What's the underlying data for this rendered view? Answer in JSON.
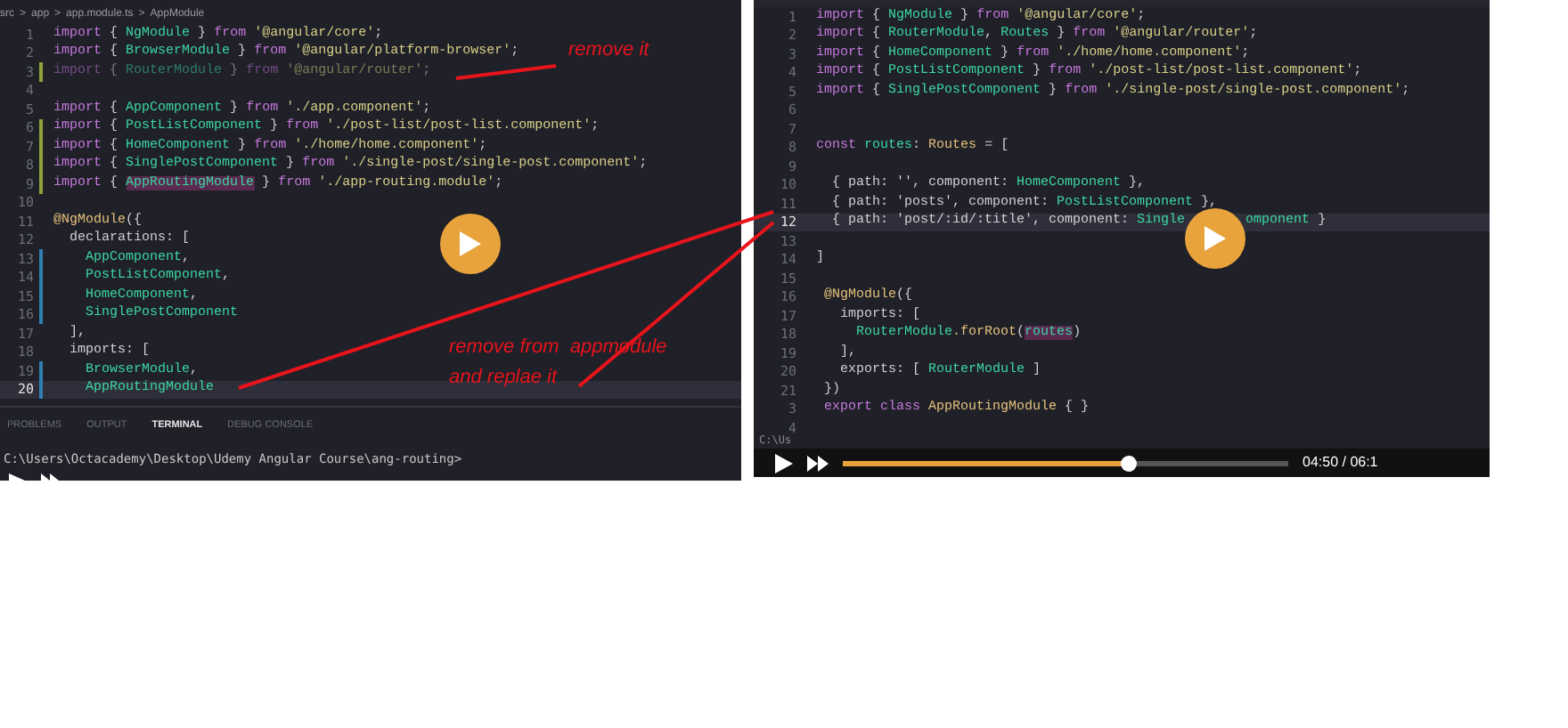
{
  "left_frame": {
    "breadcrumb": [
      "src",
      ">",
      "app",
      ">",
      "app.module.ts",
      ">",
      "AppModule"
    ],
    "code_lines": [
      {
        "number": "1",
        "current": false,
        "tokens": [
          {
            "text": "import",
            "kind": "kw"
          },
          {
            "text": " { ",
            "kind": "p"
          },
          {
            "text": "NgModule",
            "kind": "id"
          },
          {
            "text": " } ",
            "kind": "p"
          },
          {
            "text": "from ",
            "kind": "kw"
          },
          {
            "text": "'@angular/core'",
            "kind": "str"
          },
          {
            "text": ";",
            "kind": "p"
          }
        ]
      },
      {
        "number": "2",
        "current": false,
        "tokens": [
          {
            "text": "import",
            "kind": "kw"
          },
          {
            "text": " { ",
            "kind": "p"
          },
          {
            "text": "BrowserModule",
            "kind": "id"
          },
          {
            "text": " } ",
            "kind": "p"
          },
          {
            "text": "from ",
            "kind": "kw"
          },
          {
            "text": "'@angular/platform-browser'",
            "kind": "str"
          },
          {
            "text": ";",
            "kind": "p"
          }
        ]
      },
      {
        "number": "3",
        "current": false,
        "faded": true,
        "color": "#8fa33a",
        "tokens": [
          {
            "text": "import",
            "kind": "kw"
          },
          {
            "text": " { ",
            "kind": "p"
          },
          {
            "text": "RouterModule",
            "kind": "id"
          },
          {
            "text": " } ",
            "kind": "p"
          },
          {
            "text": "from ",
            "kind": "kw"
          },
          {
            "text": "'@angular/router'",
            "kind": "str"
          },
          {
            "text": ";",
            "kind": "p"
          }
        ]
      },
      {
        "number": "4",
        "current": false
      },
      {
        "number": "5",
        "current": false,
        "tokens": [
          {
            "text": "import",
            "kind": "kw"
          },
          {
            "text": " { ",
            "kind": "p"
          },
          {
            "text": "AppComponent",
            "kind": "id"
          },
          {
            "text": " } ",
            "kind": "p"
          },
          {
            "text": "from ",
            "kind": "kw"
          },
          {
            "text": "'./app.component'",
            "kind": "str"
          },
          {
            "text": ";",
            "kind": "p"
          }
        ]
      },
      {
        "number": "6",
        "current": false,
        "color": "#8fa33a",
        "tokens": [
          {
            "text": "import",
            "kind": "kw"
          },
          {
            "text": " { ",
            "kind": "p"
          },
          {
            "text": "PostListComponent",
            "kind": "id"
          },
          {
            "text": " } ",
            "kind": "p"
          },
          {
            "text": "from ",
            "kind": "kw"
          },
          {
            "text": "'./post-list/post-list.component'",
            "kind": "str"
          },
          {
            "text": ";",
            "kind": "p"
          }
        ]
      },
      {
        "number": "7",
        "current": false,
        "color": "#8fa33a",
        "tokens": [
          {
            "text": "import",
            "kind": "kw"
          },
          {
            "text": " { ",
            "kind": "p"
          },
          {
            "text": "HomeComponent",
            "kind": "id"
          },
          {
            "text": " } ",
            "kind": "p"
          },
          {
            "text": "from ",
            "kind": "kw"
          },
          {
            "text": "'./home/home.component'",
            "kind": "str"
          },
          {
            "text": ";",
            "kind": "p"
          }
        ]
      },
      {
        "number": "8",
        "current": false,
        "color": "#8fa33a",
        "tokens": [
          {
            "text": "import",
            "kind": "kw"
          },
          {
            "text": " { ",
            "kind": "p"
          },
          {
            "text": "SinglePostComponent",
            "kind": "id"
          },
          {
            "text": " } ",
            "kind": "p"
          },
          {
            "text": "from ",
            "kind": "kw"
          },
          {
            "text": "'./single-post/single-post.component'",
            "kind": "str"
          },
          {
            "text": ";",
            "kind": "p"
          }
        ]
      },
      {
        "number": "9",
        "current": false,
        "color": "#8fa33a",
        "tokens": [
          {
            "text": "import",
            "kind": "kw"
          },
          {
            "text": " { ",
            "kind": "p"
          },
          {
            "text": "AppRoutingModule",
            "kind": "id",
            "selected": true
          },
          {
            "text": " } ",
            "kind": "p"
          },
          {
            "text": "from ",
            "kind": "kw"
          },
          {
            "text": "'./app-routing.module'",
            "kind": "str"
          },
          {
            "text": ";",
            "kind": "p"
          }
        ]
      },
      {
        "number": "10",
        "current": false
      },
      {
        "number": "11",
        "current": false,
        "tokens": [
          {
            "text": "@NgModule",
            "kind": "dec"
          },
          {
            "text": "({",
            "kind": "p"
          }
        ]
      },
      {
        "number": "12",
        "current": false,
        "tokens": [
          {
            "text": "  declarations: [",
            "kind": "p"
          }
        ]
      },
      {
        "number": "13",
        "current": false,
        "color": "#2f7fb0",
        "tokens": [
          {
            "text": "    AppComponent",
            "kind": "id"
          },
          {
            "text": ",",
            "kind": "p"
          }
        ]
      },
      {
        "number": "14",
        "current": false,
        "color": "#2f7fb0",
        "tokens": [
          {
            "text": "    PostListComponent",
            "kind": "id"
          },
          {
            "text": ",",
            "kind": "p"
          }
        ]
      },
      {
        "number": "15",
        "current": false,
        "color": "#2f7fb0",
        "tokens": [
          {
            "text": "    HomeComponent",
            "kind": "id"
          },
          {
            "text": ",",
            "kind": "p"
          }
        ]
      },
      {
        "number": "16",
        "current": false,
        "color": "#2f7fb0",
        "tokens": [
          {
            "text": "    SinglePostComponent",
            "kind": "id"
          }
        ]
      },
      {
        "number": "17",
        "current": false,
        "tokens": [
          {
            "text": "  ],",
            "kind": "p"
          }
        ]
      },
      {
        "number": "18",
        "current": false,
        "tokens": [
          {
            "text": "  imports: [",
            "kind": "p"
          }
        ]
      },
      {
        "number": "19",
        "current": false,
        "color": "#2f7fb0",
        "tokens": [
          {
            "text": "    BrowserModule",
            "kind": "id"
          },
          {
            "text": ",",
            "kind": "p"
          }
        ]
      },
      {
        "number": "20",
        "current": true,
        "color": "#2f7fb0",
        "tokens": [
          {
            "text": "    AppRoutingModule",
            "kind": "id"
          }
        ]
      }
    ],
    "panel_tabs": [
      {
        "label": "PROBLEMS",
        "selected": false
      },
      {
        "label": "OUTPUT",
        "selected": false
      },
      {
        "label": "TERMINAL",
        "selected": true
      },
      {
        "label": "DEBUG CONSOLE",
        "selected": false
      }
    ],
    "terminal_line": "C:\\Users\\Octacademy\\Desktop\\Udemy Angular Course\\ang-routing>"
  },
  "right_frame": {
    "code_lines": [
      {
        "number": "1",
        "current": false,
        "tokens": [
          {
            "text": "import",
            "kind": "kw"
          },
          {
            "text": " { ",
            "kind": "p"
          },
          {
            "text": "NgModule",
            "kind": "id"
          },
          {
            "text": " } ",
            "kind": "p"
          },
          {
            "text": "from ",
            "kind": "kw"
          },
          {
            "text": "'@angular/core'",
            "kind": "str"
          },
          {
            "text": ";",
            "kind": "p"
          }
        ]
      },
      {
        "number": "2",
        "current": false,
        "tokens": [
          {
            "text": "import",
            "kind": "kw"
          },
          {
            "text": " { ",
            "kind": "p"
          },
          {
            "text": "RouterModule",
            "kind": "id"
          },
          {
            "text": ", ",
            "kind": "p"
          },
          {
            "text": "Routes",
            "kind": "id"
          },
          {
            "text": " } ",
            "kind": "p"
          },
          {
            "text": "from ",
            "kind": "kw"
          },
          {
            "text": "'@angular/router'",
            "kind": "str"
          },
          {
            "text": ";",
            "kind": "p"
          }
        ]
      },
      {
        "number": "3",
        "current": false,
        "tokens": [
          {
            "text": "import",
            "kind": "kw"
          },
          {
            "text": " { ",
            "kind": "p"
          },
          {
            "text": "HomeComponent",
            "kind": "id"
          },
          {
            "text": " } ",
            "kind": "p"
          },
          {
            "text": "from ",
            "kind": "kw"
          },
          {
            "text": "'./home/home.component'",
            "kind": "str"
          },
          {
            "text": ";",
            "kind": "p"
          }
        ]
      },
      {
        "number": "4",
        "current": false,
        "tokens": [
          {
            "text": "import",
            "kind": "kw"
          },
          {
            "text": " { ",
            "kind": "p"
          },
          {
            "text": "PostListComponent",
            "kind": "id"
          },
          {
            "text": " } ",
            "kind": "p"
          },
          {
            "text": "from ",
            "kind": "kw"
          },
          {
            "text": "'./post-list/post-list.component'",
            "kind": "str"
          },
          {
            "text": ";",
            "kind": "p"
          }
        ]
      },
      {
        "number": "5",
        "current": false,
        "tokens": [
          {
            "text": "import",
            "kind": "kw"
          },
          {
            "text": " { ",
            "kind": "p"
          },
          {
            "text": "SinglePostComponent",
            "kind": "id"
          },
          {
            "text": " } ",
            "kind": "p"
          },
          {
            "text": "from ",
            "kind": "kw"
          },
          {
            "text": "'./single-post/single-post.component'",
            "kind": "str"
          },
          {
            "text": ";",
            "kind": "p"
          }
        ]
      },
      {
        "number": "6",
        "current": false
      },
      {
        "number": "7",
        "current": false
      },
      {
        "number": "8",
        "current": false,
        "tokens": [
          {
            "text": "const ",
            "kind": "kw"
          },
          {
            "text": "routes",
            "kind": "id"
          },
          {
            "text": ": ",
            "kind": "p"
          },
          {
            "text": "Routes",
            "kind": "dec"
          },
          {
            "text": " = [",
            "kind": "p"
          }
        ]
      },
      {
        "number": "9",
        "current": false
      },
      {
        "number": "10",
        "current": false,
        "tokens": [
          {
            "text": "  { path: '', component: ",
            "kind": "p"
          },
          {
            "text": "HomeComponent",
            "kind": "id"
          },
          {
            "text": " },",
            "kind": "p"
          }
        ]
      },
      {
        "number": "11",
        "current": false,
        "tokens": [
          {
            "text": "  { path: 'posts', component: ",
            "kind": "p"
          },
          {
            "text": "PostListComponent",
            "kind": "id"
          },
          {
            "text": " },",
            "kind": "p"
          }
        ]
      },
      {
        "number": "12",
        "current": true,
        "tokens": [
          {
            "text": "  { path: 'post/:id/:title', component: ",
            "kind": "p"
          },
          {
            "text": "Single",
            "kind": "id"
          },
          {
            "text": "omponent",
            "kind": "id",
            "covered_before": true
          },
          {
            "text": " }",
            "kind": "p"
          }
        ]
      },
      {
        "number": "13",
        "current": false
      },
      {
        "number": "14",
        "current": false,
        "tokens": [
          {
            "text": "]",
            "kind": "p"
          }
        ]
      },
      {
        "number": "15",
        "current": false
      },
      {
        "number": "16",
        "current": false,
        "tokens": [
          {
            "text": " @NgModule",
            "kind": "dec"
          },
          {
            "text": "({",
            "kind": "p"
          }
        ]
      },
      {
        "number": "17",
        "current": false,
        "tokens": [
          {
            "text": "   imports: [",
            "kind": "p"
          }
        ]
      },
      {
        "number": "18",
        "current": false,
        "tokens": [
          {
            "text": "     RouterModule",
            "kind": "id"
          },
          {
            "text": ".forRoot",
            "kind": "dec"
          },
          {
            "text": "(",
            "kind": "p"
          },
          {
            "text": "routes",
            "kind": "id",
            "selected": true
          },
          {
            "text": ")",
            "kind": "p"
          }
        ]
      },
      {
        "number": "19",
        "current": false,
        "tokens": [
          {
            "text": "   ],",
            "kind": "p"
          }
        ]
      },
      {
        "number": "20",
        "current": false,
        "tokens": [
          {
            "text": "   exports: [ ",
            "kind": "p"
          },
          {
            "text": "RouterModule",
            "kind": "id"
          },
          {
            "text": " ]",
            "kind": "p"
          }
        ]
      },
      {
        "number": "21",
        "current": false,
        "tokens": [
          {
            "text": " })",
            "kind": "p"
          }
        ]
      },
      {
        "number": "3",
        "current": false,
        "tokens": [
          {
            "text": " export class ",
            "kind": "kw"
          },
          {
            "text": "AppRoutingModule",
            "kind": "dec"
          },
          {
            "text": " { }",
            "kind": "p"
          }
        ]
      },
      {
        "number": "4",
        "current": false
      }
    ],
    "terminal_line": "C:\\Us",
    "player": {
      "level": 0.64,
      "time": "04:50 / 06:1"
    }
  },
  "annotations": [
    {
      "text": "remove it"
    },
    {
      "text": "remove from  appmodule"
    },
    {
      "text": "and replae it"
    }
  ]
}
